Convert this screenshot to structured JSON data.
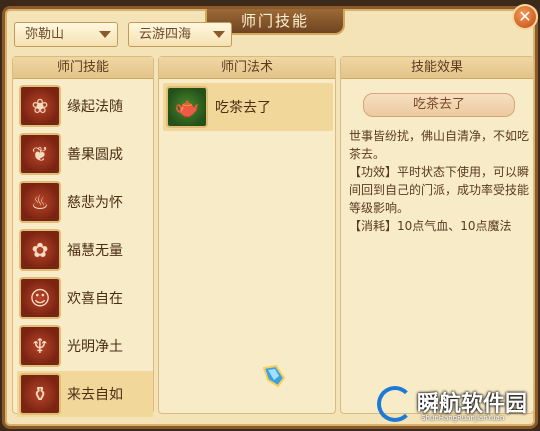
{
  "window": {
    "title": "师门技能"
  },
  "filters": {
    "school_select": "弥勒山",
    "area_select": "云游四海"
  },
  "panels": {
    "skills_header": "师门技能",
    "spells_header": "师门法术",
    "effect_header": "技能效果"
  },
  "skills": [
    {
      "label": "缘起法随",
      "icon": "lotus-skill-icon"
    },
    {
      "label": "善果圆成",
      "icon": "fruit-skill-icon"
    },
    {
      "label": "慈悲为怀",
      "icon": "buddha-skill-icon"
    },
    {
      "label": "福慧无量",
      "icon": "flower-skill-icon"
    },
    {
      "label": "欢喜自在",
      "icon": "joy-skill-icon"
    },
    {
      "label": "光明净土",
      "icon": "flame-skill-icon"
    },
    {
      "label": "来去自如",
      "icon": "vase-skill-icon"
    }
  ],
  "selected_skill_index": 6,
  "spells": [
    {
      "label": "吃茶去了",
      "icon": "teapot-spell-icon"
    }
  ],
  "effect": {
    "name": "吃茶去了",
    "description": "世事皆纷扰，佛山自清净，不如吃茶去。",
    "function_text": "【功效】平时状态下使用，可以瞬间回到自己的门派，成功率受技能等级影响。",
    "cost_text": "【消耗】10点气血、10点魔法"
  },
  "watermark": {
    "text": "瞬航软件园",
    "sub": "ShunHangRuanJianYuan"
  },
  "colors": {
    "accent": "#8a5a2a",
    "selected_row": "#f2d79a",
    "close": "#c04a14"
  }
}
